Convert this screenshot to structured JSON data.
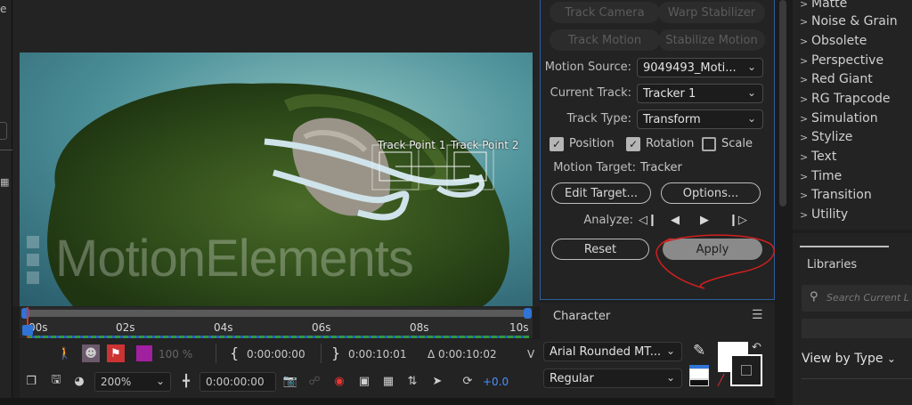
{
  "left_strip": {
    "top_fragment": "e"
  },
  "viewer": {
    "track_point_1": "Track Point 1",
    "track_point_2": "Track Point 2",
    "watermark": "MotionElements"
  },
  "timeline": {
    "ticks": [
      "00s",
      "02s",
      "04s",
      "06s",
      "08s",
      "10s"
    ]
  },
  "viewer_toolbar": {
    "row1": {
      "zoom_percent": "100 %",
      "current_time": "0:00:00:00",
      "end_time": "0:00:10:01",
      "duration": "Δ 0:00:10:02",
      "trailing": "V"
    },
    "row2": {
      "magnification": "200%",
      "time": "0:00:00:00",
      "exposure": "+0.0"
    }
  },
  "tracker": {
    "buttons_top": [
      "Track Camera",
      "Warp Stabilizer",
      "Track Motion",
      "Stabilize Motion"
    ],
    "motion_source_label": "Motion Source:",
    "motion_source_value": "9049493_Moti...",
    "current_track_label": "Current Track:",
    "current_track_value": "Tracker 1",
    "track_type_label": "Track Type:",
    "track_type_value": "Transform",
    "position_label": "Position",
    "rotation_label": "Rotation",
    "scale_label": "Scale",
    "motion_target_label": "Motion Target:",
    "motion_target_value": "Tracker",
    "edit_target": "Edit Target...",
    "options": "Options...",
    "analyze_label": "Analyze:",
    "reset": "Reset",
    "apply": "Apply",
    "checks": {
      "position": true,
      "rotation": true,
      "scale": false
    },
    "annotation_color": "#d11f1f"
  },
  "character": {
    "title": "Character",
    "font": "Arial Rounded MT...",
    "style": "Regular"
  },
  "effects": {
    "items": [
      "Matte",
      "Noise & Grain",
      "Obsolete",
      "Perspective",
      "Red Giant",
      "RG Trapcode",
      "Simulation",
      "Stylize",
      "Text",
      "Time",
      "Transition",
      "Utility"
    ]
  },
  "libraries": {
    "tab": "Libraries",
    "search_placeholder": "Search Current L",
    "view_by": "View by Type"
  },
  "colors": {
    "accent_blue": "#2f74d6",
    "panel_focus": "#2d5f9e",
    "magenta_swatch": "#a020a0"
  }
}
